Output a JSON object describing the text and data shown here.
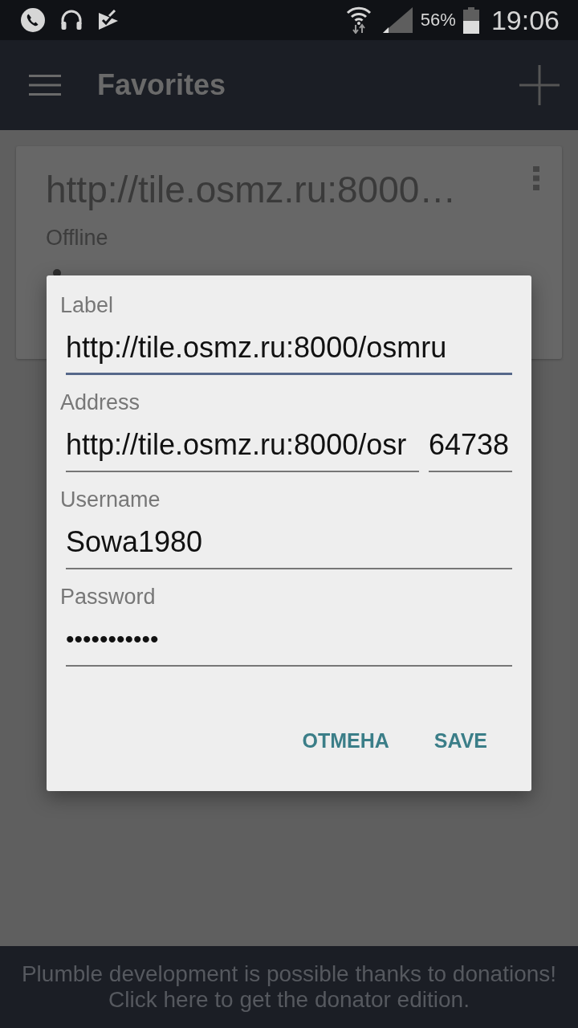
{
  "status_bar": {
    "battery": "56%",
    "time": "19:06"
  },
  "app_bar": {
    "title": "Favorites"
  },
  "servers": [
    {
      "title": "http://tile.osmz.ru:8000…",
      "status": "Offline"
    }
  ],
  "dialog": {
    "fields": [
      {
        "label": "Label",
        "kind": "text",
        "inputs": [
          {
            "value": "http://tile.osmz.ru:8000/osmru",
            "focused": true
          }
        ]
      },
      {
        "label": "Address",
        "kind": "text",
        "inputs": [
          {
            "value": "http://tile.osmz.ru:8000/osr",
            "focused": false
          },
          {
            "value": "64738",
            "focused": false
          }
        ]
      },
      {
        "label": "Username",
        "kind": "text",
        "inputs": [
          {
            "value": "Sowa1980",
            "focused": false
          }
        ]
      },
      {
        "label": "Password",
        "kind": "password",
        "inputs": [
          {
            "value": "•••••••••••",
            "focused": false
          }
        ]
      }
    ],
    "buttons": [
      "ОТМЕНА",
      "SAVE"
    ]
  },
  "banner": {
    "lines": [
      "Plumble development is possible thanks to donations!",
      "Click here to get the donator edition."
    ]
  }
}
